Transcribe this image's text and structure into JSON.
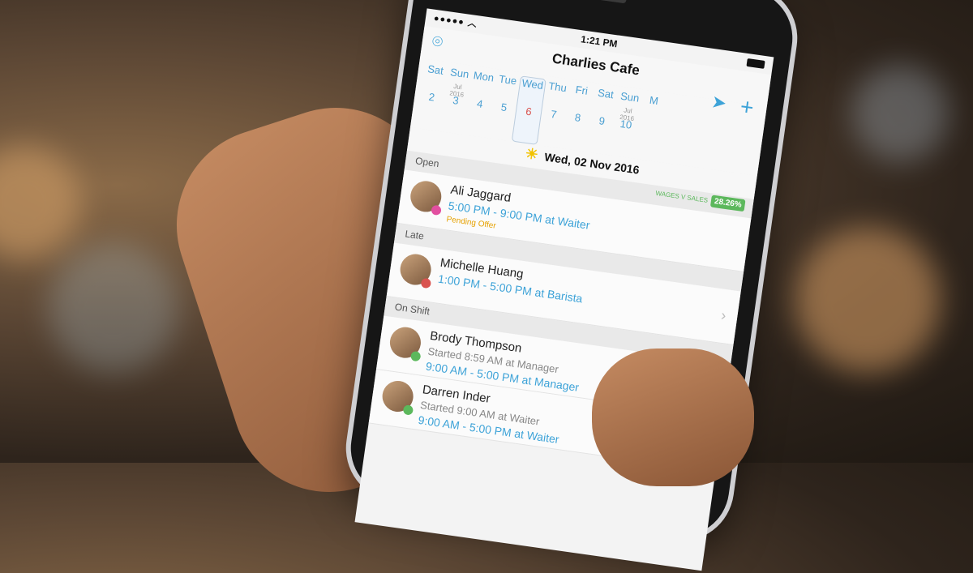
{
  "status_bar": {
    "time": "1:21 PM"
  },
  "header": {
    "title": "Charlies Cafe"
  },
  "week": [
    {
      "name": "Sat",
      "date": "2",
      "month": ""
    },
    {
      "name": "Sun",
      "date": "3",
      "month": "Jul 2016"
    },
    {
      "name": "Mon",
      "date": "4",
      "month": ""
    },
    {
      "name": "Tue",
      "date": "5",
      "month": ""
    },
    {
      "name": "Wed",
      "date": "6",
      "month": "",
      "selected": true
    },
    {
      "name": "Thu",
      "date": "7",
      "month": ""
    },
    {
      "name": "Fri",
      "date": "8",
      "month": ""
    },
    {
      "name": "Sat",
      "date": "9",
      "month": ""
    },
    {
      "name": "Sun",
      "date": "10",
      "month": "Jul 2016"
    },
    {
      "name": "M",
      "date": "",
      "month": ""
    }
  ],
  "current_date": "Wed, 02 Nov 2016",
  "wages": {
    "label": "WAGES V SALES",
    "value": "28.26%"
  },
  "sections": [
    {
      "label": "Open",
      "rows": [
        {
          "name": "Ali Jaggard",
          "shift": "5:00 PM - 9:00 PM at Waiter",
          "note": "Pending Offer",
          "dot_color": "#e24fa0"
        }
      ]
    },
    {
      "label": "Late",
      "rows": [
        {
          "name": "Michelle Huang",
          "shift": "1:00 PM - 5:00 PM at Barista",
          "dot_color": "#d9534f"
        }
      ]
    },
    {
      "label": "On Shift",
      "rows": [
        {
          "name": "Brody Thompson",
          "started": "Started 8:59 AM at Manager",
          "shift": "9:00 AM - 5:00 PM at Manager",
          "dot_color": "#5cb85c"
        },
        {
          "name": "Darren Inder",
          "started": "Started 9:00 AM at Waiter",
          "shift": "9:00 AM - 5:00 PM at Waiter",
          "dot_color": "#5cb85c"
        }
      ]
    }
  ],
  "icons": {
    "logo": "map-pin-logo-icon",
    "send": "paper-plane-icon",
    "add": "plus-icon",
    "weather": "sun-icon",
    "chevron": "chevron-right-icon"
  },
  "colors": {
    "accent": "#3ea3d8",
    "late": "#d9534f",
    "ok": "#5cb85c",
    "pending": "#e6a100"
  }
}
